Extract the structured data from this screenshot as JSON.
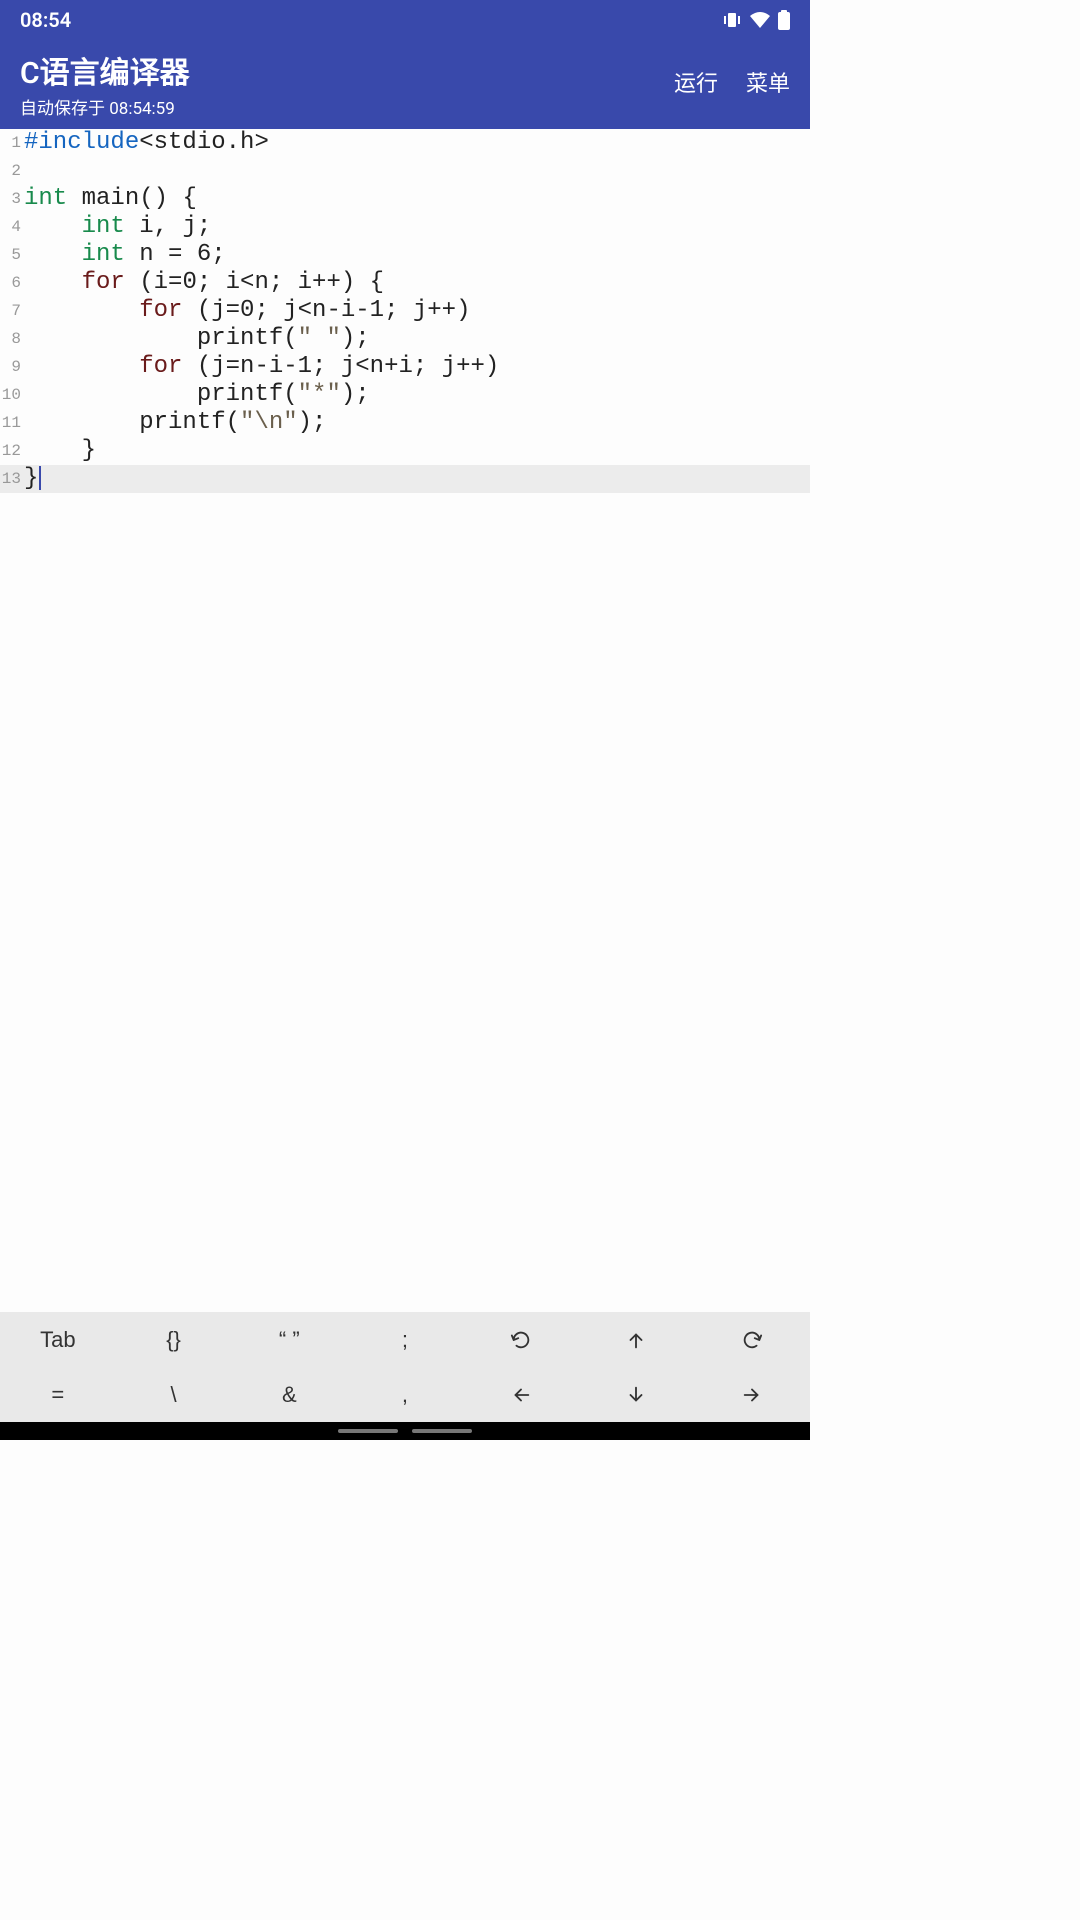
{
  "status": {
    "time": "08:54"
  },
  "header": {
    "title": "C语言编译器",
    "subtitle": "自动保存于 08:54:59",
    "run": "运行",
    "menu": "菜单"
  },
  "code": {
    "lines": [
      {
        "n": "1",
        "tokens": [
          {
            "t": "#include",
            "c": "tok-preproc"
          },
          {
            "t": "<stdio.h>",
            "c": ""
          }
        ]
      },
      {
        "n": "2",
        "tokens": []
      },
      {
        "n": "3",
        "tokens": [
          {
            "t": "int",
            "c": "tok-keyword"
          },
          {
            "t": " main() {",
            "c": ""
          }
        ]
      },
      {
        "n": "4",
        "tokens": [
          {
            "t": "    ",
            "c": ""
          },
          {
            "t": "int",
            "c": "tok-keyword"
          },
          {
            "t": " i, j;",
            "c": ""
          }
        ]
      },
      {
        "n": "5",
        "tokens": [
          {
            "t": "    ",
            "c": ""
          },
          {
            "t": "int",
            "c": "tok-keyword"
          },
          {
            "t": " n = 6;",
            "c": ""
          }
        ]
      },
      {
        "n": "6",
        "tokens": [
          {
            "t": "    ",
            "c": ""
          },
          {
            "t": "for",
            "c": "tok-ctrl"
          },
          {
            "t": " (i=0; i<n; i++) {",
            "c": ""
          }
        ]
      },
      {
        "n": "7",
        "tokens": [
          {
            "t": "        ",
            "c": ""
          },
          {
            "t": "for",
            "c": "tok-ctrl"
          },
          {
            "t": " (j=0; j<n-i-1; j++)",
            "c": ""
          }
        ]
      },
      {
        "n": "8",
        "tokens": [
          {
            "t": "            printf(",
            "c": ""
          },
          {
            "t": "\" \"",
            "c": "tok-string"
          },
          {
            "t": ");",
            "c": ""
          }
        ]
      },
      {
        "n": "9",
        "tokens": [
          {
            "t": "        ",
            "c": ""
          },
          {
            "t": "for",
            "c": "tok-ctrl"
          },
          {
            "t": " (j=n-i-1; j<n+i; j++)",
            "c": ""
          }
        ]
      },
      {
        "n": "10",
        "tokens": [
          {
            "t": "            printf(",
            "c": ""
          },
          {
            "t": "\"*\"",
            "c": "tok-string"
          },
          {
            "t": ");",
            "c": ""
          }
        ]
      },
      {
        "n": "11",
        "tokens": [
          {
            "t": "        printf(",
            "c": ""
          },
          {
            "t": "\"\\n\"",
            "c": "tok-string"
          },
          {
            "t": ");",
            "c": ""
          }
        ]
      },
      {
        "n": "12",
        "tokens": [
          {
            "t": "    }",
            "c": ""
          }
        ]
      },
      {
        "n": "13",
        "tokens": [
          {
            "t": "}",
            "c": ""
          }
        ],
        "active": true,
        "cursor": true
      }
    ]
  },
  "toolbar": {
    "row1": [
      "Tab",
      "{}",
      "“ ”",
      ";"
    ],
    "row2": [
      "=",
      "\\",
      "&",
      ","
    ]
  }
}
